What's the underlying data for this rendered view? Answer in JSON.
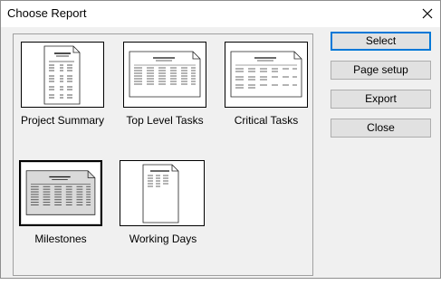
{
  "dialog": {
    "title": "Choose Report",
    "close_glyph": "✕"
  },
  "reports": [
    {
      "label": "Project Summary",
      "icon": "portrait-summary-report-icon",
      "selected": false
    },
    {
      "label": "Top Level Tasks",
      "icon": "landscape-table-report-icon",
      "selected": false
    },
    {
      "label": "Critical Tasks",
      "icon": "landscape-table-report-icon",
      "selected": false
    },
    {
      "label": "Milestones",
      "icon": "landscape-table-report-icon",
      "selected": true
    },
    {
      "label": "Working Days",
      "icon": "portrait-calendar-report-icon",
      "selected": false
    }
  ],
  "buttons": {
    "select": "Select",
    "page_setup": "Page setup",
    "export": "Export",
    "close": "Close"
  }
}
